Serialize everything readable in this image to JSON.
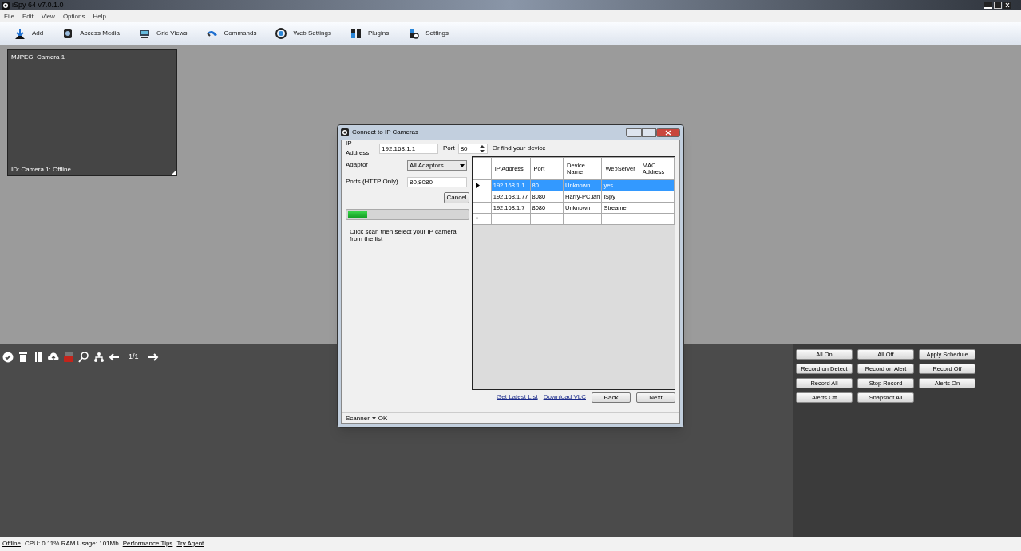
{
  "window": {
    "title": "iSpy 64 v7.0.1.0"
  },
  "menu": [
    "File",
    "Edit",
    "View",
    "Options",
    "Help"
  ],
  "toolbar": [
    {
      "label": "Add",
      "kind": "add"
    },
    {
      "label": "Access Media",
      "kind": "media"
    },
    {
      "label": "Grid Views",
      "kind": "grid"
    },
    {
      "label": "Commands",
      "kind": "commands"
    },
    {
      "label": "Web Settings",
      "kind": "web"
    },
    {
      "label": "Plugins",
      "kind": "plugins"
    },
    {
      "label": "Settings",
      "kind": "settings"
    }
  ],
  "camera": {
    "title": "MJPEG: Camera 1",
    "status": "ID: Camera 1: Offline"
  },
  "view_toolbar": {
    "page": "1/1"
  },
  "command_buttons": [
    "All On",
    "All Off",
    "Apply Schedule",
    "Record on Detect",
    "Record on Alert",
    "Record Off",
    "Record All",
    "Stop Record",
    "Alerts On",
    "Alerts Off",
    "Snapshot All"
  ],
  "dialog": {
    "title": "Connect to IP Cameras",
    "ip_label": "IP Address",
    "ip_value": "192.168.1.1",
    "port_label": "Port",
    "port_value": "80",
    "find_label": "Or find your device",
    "adaptor_label": "Adaptor",
    "adaptor_value": "All Adaptors",
    "ports_label": "Ports (HTTP Only)",
    "ports_value": "80,8080",
    "cancel": "Cancel",
    "progress": {
      "level": 0.16
    },
    "hint": "Click scan then select your IP camera from the list",
    "table": {
      "columns": [
        "IP Address",
        "Port",
        "Device Name",
        "WebServer",
        "MAC Address"
      ],
      "rows": [
        {
          "selected": true,
          "cells": [
            "192.168.1.1",
            "80",
            "Unknown",
            "yes",
            ""
          ]
        },
        {
          "selected": false,
          "cells": [
            "192.168.1.77",
            "8080",
            "Harry-PC.lan",
            "iSpy",
            ""
          ]
        },
        {
          "selected": false,
          "cells": [
            "192.168.1.7",
            "8080",
            "Unknown",
            "Streamer",
            ""
          ]
        }
      ],
      "new_row_marker": "*"
    },
    "links": [
      "Get Latest List",
      "Download VLC"
    ],
    "buttons": [
      "Back",
      "Next"
    ],
    "status": {
      "menu": "Scanner",
      "text": "OK"
    }
  },
  "status_bar": {
    "state": "Offline",
    "stats": "CPU: 0.11% RAM Usage: 101Mb",
    "links": [
      "Performance Tips",
      "Try Agent"
    ]
  }
}
